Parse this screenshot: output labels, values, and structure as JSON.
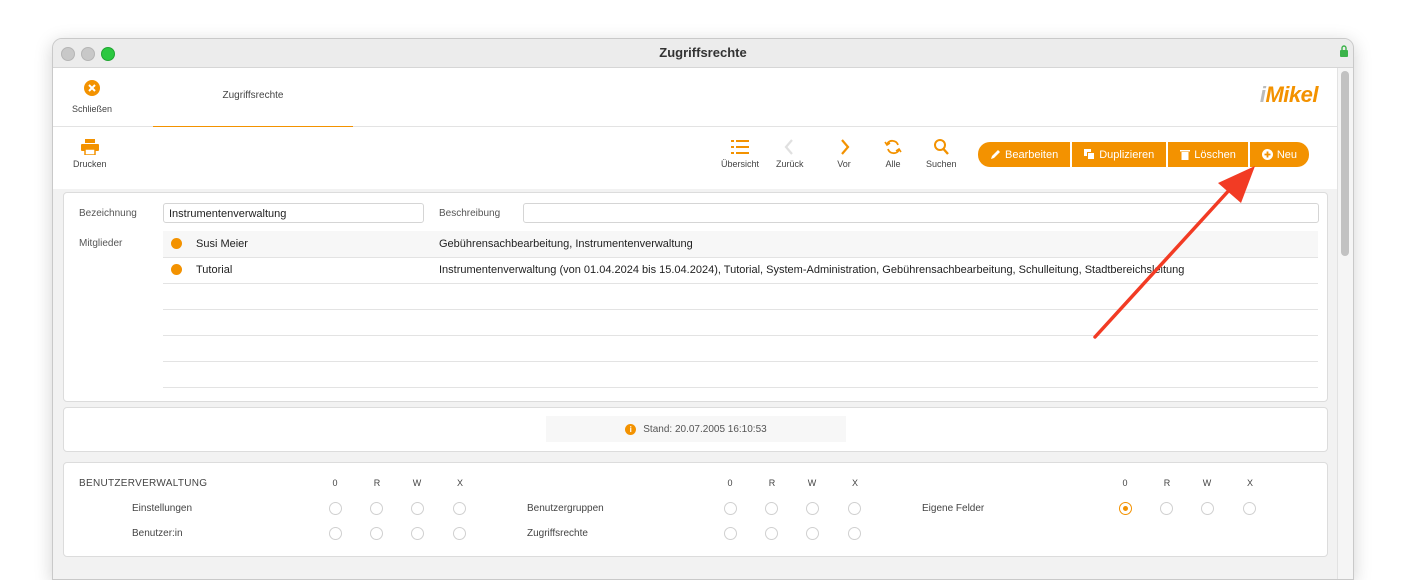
{
  "window": {
    "title": "Zugriffsrechte"
  },
  "topbar": {
    "close_label": "Schließen",
    "tab_label": "Zugriffsrechte",
    "logo_prefix": "i",
    "logo_text": "Mikel"
  },
  "toolbar": {
    "print_label": "Drucken",
    "overview_label": "Übersicht",
    "back_label": "Zurück",
    "forward_label": "Vor",
    "all_label": "Alle",
    "search_label": "Suchen",
    "edit_label": "Bearbeiten",
    "duplicate_label": "Duplizieren",
    "delete_label": "Löschen",
    "new_label": "Neu"
  },
  "form": {
    "name_label": "Bezeichnung",
    "name_value": "Instrumentenverwaltung",
    "desc_label": "Beschreibung",
    "desc_value": "",
    "members_label": "Mitglieder",
    "members": [
      {
        "name": "Susi Meier",
        "groups": "Gebührensachbearbeitung, Instrumentenverwaltung"
      },
      {
        "name": "Tutorial",
        "groups": "Instrumentenverwaltung (von 01.04.2024 bis 15.04.2024), Tutorial, System-Administration, Gebührensachbearbeitung, Schulleitung, Stadtbereichsleitung"
      }
    ]
  },
  "status": {
    "stand": "Stand: 20.07.2005 16:10:53"
  },
  "permissions": {
    "section_title": "BENUTZERVERWALTUNG",
    "columns": [
      "0",
      "R",
      "W",
      "X"
    ],
    "items": {
      "einstellungen": "Einstellungen",
      "benutzer": "Benutzer:in",
      "benutzergruppen": "Benutzergruppen",
      "zugriffsrechte": "Zugriffsrechte",
      "eigene_felder": "Eigene Felder"
    },
    "selected": {
      "eigene_felder": "0"
    }
  },
  "colors": {
    "accent": "#f39200",
    "annotation_arrow": "#f23b24"
  }
}
